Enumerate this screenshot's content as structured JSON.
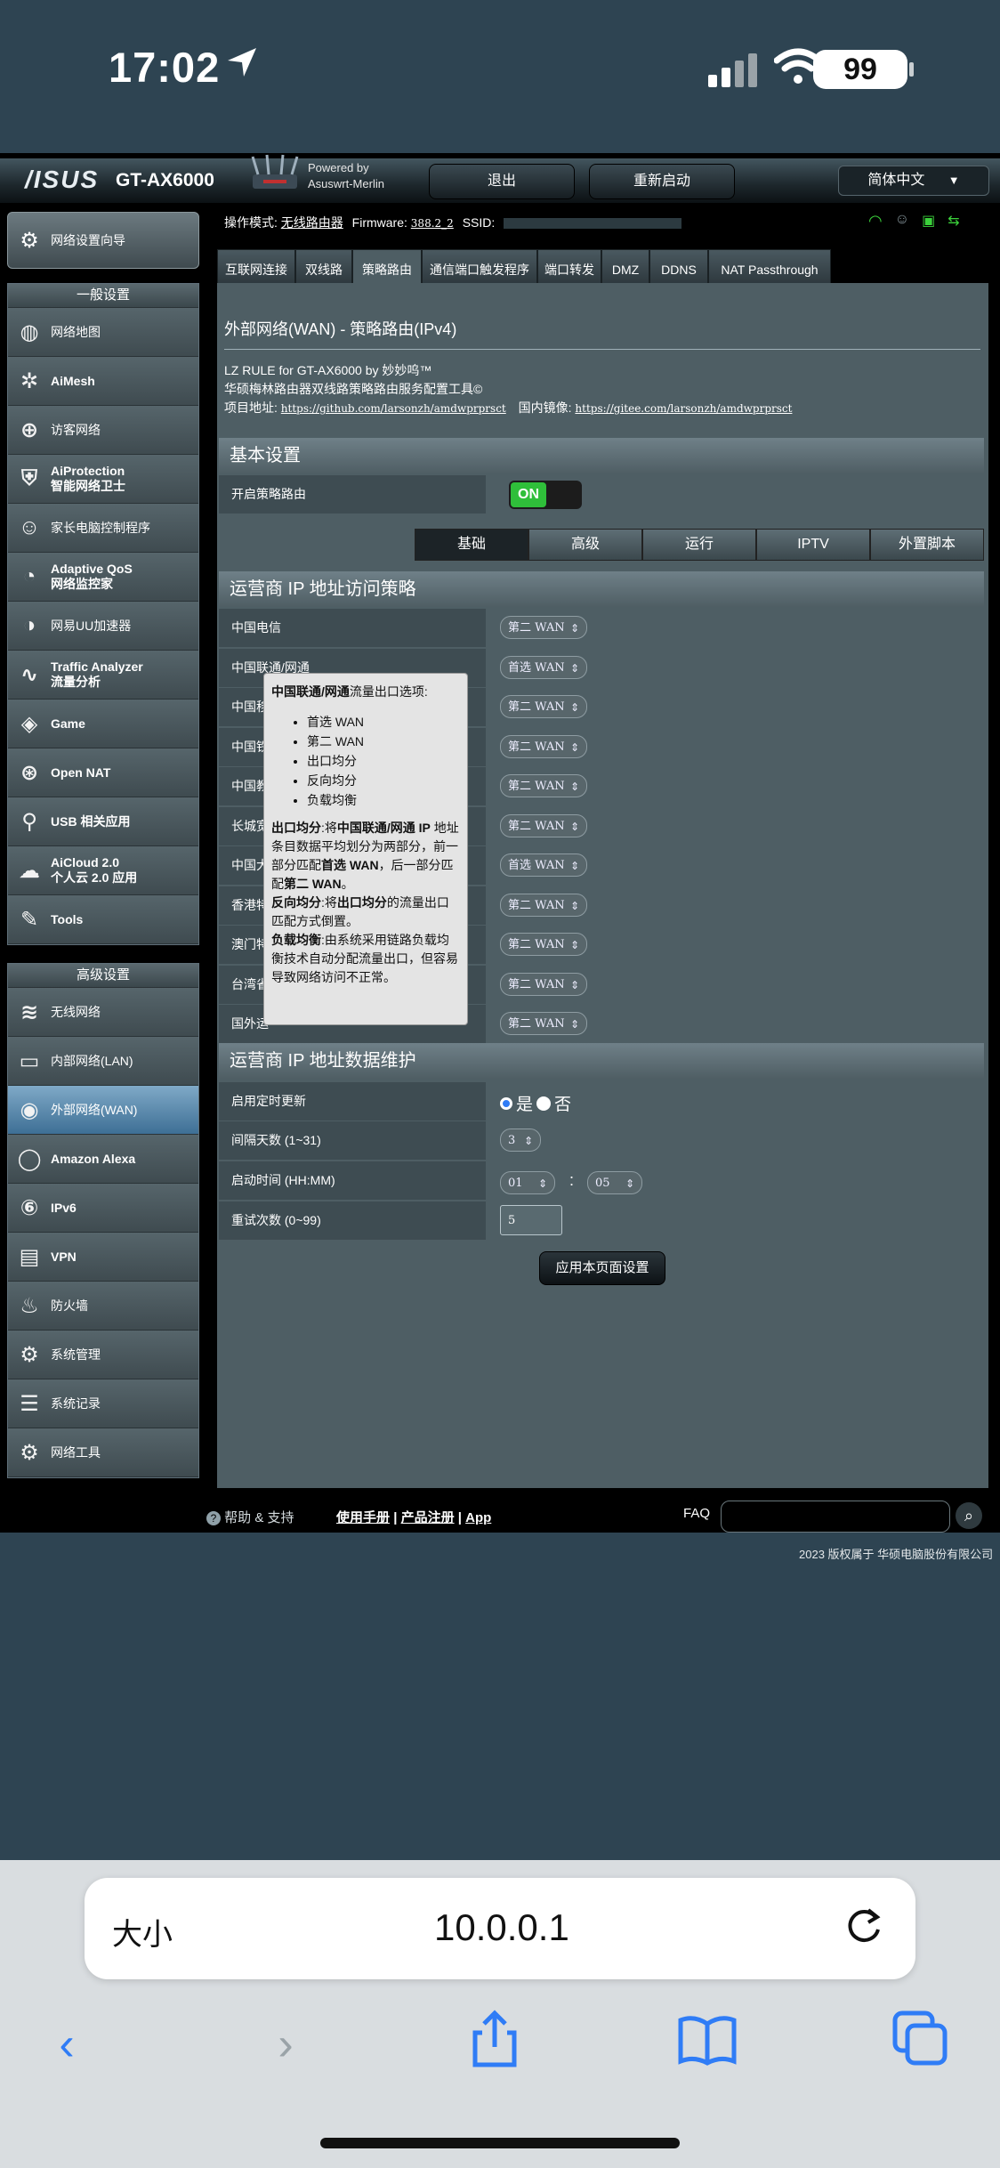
{
  "status_bar": {
    "time": "17:02",
    "battery": "99"
  },
  "header": {
    "logo": "/ISUS",
    "model": "GT-AX6000",
    "powered_by_line1": "Powered by",
    "powered_by_line2": "Asuswrt-Merlin",
    "logout_label": "退出",
    "reboot_label": "重新启动",
    "language": "简体中文"
  },
  "info_bar": {
    "op_mode_label": "操作模式:",
    "op_mode_value": "无线路由器",
    "firmware_label": "Firmware:",
    "firmware_value": "388.2_2",
    "ssid_label": "SSID:"
  },
  "sidebar": {
    "quick_setup": "网络设置向导",
    "general_header": "一般设置",
    "general_items": [
      {
        "icon": "network-map-icon",
        "label": "网络地图"
      },
      {
        "icon": "aimesh-icon",
        "label": "AiMesh"
      },
      {
        "icon": "guest-network-icon",
        "label": "访客网络"
      },
      {
        "icon": "aiprotection-icon",
        "label": "AiProtection",
        "label2": "智能网络卫士"
      },
      {
        "icon": "parental-control-icon",
        "label": "家长电脑控制程序"
      },
      {
        "icon": "qos-icon",
        "label": "Adaptive QoS",
        "label2": "网络监控家"
      },
      {
        "icon": "uu-accelerator-icon",
        "label": "网易UU加速器"
      },
      {
        "icon": "traffic-analyzer-icon",
        "label": "Traffic Analyzer",
        "label2": "流量分析"
      },
      {
        "icon": "game-icon",
        "label": "Game"
      },
      {
        "icon": "open-nat-icon",
        "label": "Open NAT"
      },
      {
        "icon": "usb-icon",
        "label": "USB 相关应用"
      },
      {
        "icon": "aicloud-icon",
        "label": "AiCloud 2.0",
        "label2": "个人云 2.0 应用"
      },
      {
        "icon": "tools-icon",
        "label": "Tools"
      }
    ],
    "advanced_header": "高级设置",
    "advanced_items": [
      {
        "icon": "wireless-icon",
        "label": "无线网络"
      },
      {
        "icon": "lan-icon",
        "label": "内部网络(LAN)"
      },
      {
        "icon": "wan-icon",
        "label": "外部网络(WAN)",
        "active": true
      },
      {
        "icon": "alexa-icon",
        "label": "Amazon Alexa"
      },
      {
        "icon": "ipv6-icon",
        "label": "IPv6"
      },
      {
        "icon": "vpn-icon",
        "label": "VPN"
      },
      {
        "icon": "firewall-icon",
        "label": "防火墙"
      },
      {
        "icon": "admin-icon",
        "label": "系统管理"
      },
      {
        "icon": "syslog-icon",
        "label": "系统记录"
      },
      {
        "icon": "network-tools-icon",
        "label": "网络工具"
      }
    ]
  },
  "tabs": [
    "互联网连接",
    "双线路",
    "策略路由",
    "通信端口触发程序",
    "端口转发",
    "DMZ",
    "DDNS",
    "NAT Passthrough"
  ],
  "page": {
    "title": "外部网络(WAN) - 策略路由(IPv4)",
    "desc1": "LZ RULE for GT-AX6000 by 妙妙呜™",
    "desc2": "华硕梅林路由器双线路策略路由服务配置工具©",
    "project_label": "项目地址:",
    "project_link": "https://github.com/larsonzh/amdwprprsct",
    "mirror_label": "国内镜像:",
    "mirror_link": "https://gitee.com/larsonzh/amdwprprsct"
  },
  "basic": {
    "header": "基本设置",
    "enable_label": "开启策略路由",
    "toggle": "ON"
  },
  "subtabs": [
    "基础",
    "高级",
    "运行",
    "IPTV",
    "外置脚本"
  ],
  "isp_section": {
    "header": "运营商 IP 地址访问策略",
    "rows": [
      {
        "label": "中国电信",
        "value": "第二 WAN"
      },
      {
        "label": "中国联通/网通",
        "value": "首选 WAN"
      },
      {
        "label": "中国移",
        "value": "第二 WAN"
      },
      {
        "label": "中国铁",
        "value": "第二 WAN"
      },
      {
        "label": "中国教",
        "value": "第二 WAN"
      },
      {
        "label": "长城宽",
        "value": "第二 WAN"
      },
      {
        "label": "中国大",
        "value": "首选 WAN"
      },
      {
        "label": "香港特",
        "value": "第二 WAN"
      },
      {
        "label": "澳门特",
        "value": "第二 WAN"
      },
      {
        "label": "台湾省",
        "value": "第二 WAN"
      },
      {
        "label": "国外运",
        "value": "第二 WAN"
      }
    ]
  },
  "tooltip": {
    "title_bold": "中国联通/网通",
    "title_rest": "流量出口选项:",
    "options": [
      "首选 WAN",
      "第二 WAN",
      "出口均分",
      "反向均分",
      "负载均衡"
    ],
    "p1_bold": "出口均分",
    "p1_a": ":将",
    "p1_b": "中国联通/网通 IP",
    "p1_c": " 地址条目数据平均划分为两部分，前一部分匹配",
    "p1_d": "首选 WAN",
    "p1_e": "，后一部分匹配",
    "p1_f": "第二 WAN",
    "p1_g": "。",
    "p2_bold": "反向均分",
    "p2_a": ":将",
    "p2_b": "出口均分",
    "p2_c": "的流量出口匹配方式倒置。",
    "p3_bold": "负载均衡",
    "p3_a": ":由系统采用链路负载均衡技术自动分配流量出口，但容易导致网络访问不正常。"
  },
  "maint_section": {
    "header": "运营商 IP 地址数据维护",
    "auto_update_label": "启用定时更新",
    "yes": "是",
    "no": "否",
    "interval_label": "间隔天数 (1~31)",
    "interval_value": "3",
    "time_label": "启动时间 (HH:MM)",
    "hour": "01",
    "colon": ":",
    "minute": "05",
    "retry_label": "重试次数 (0~99)",
    "retry_value": "5"
  },
  "apply_button": "应用本页面设置",
  "footer": {
    "help": "帮助 & 支持",
    "manual": "使用手册",
    "sep": "|",
    "register": "产品注册",
    "app": "App",
    "faq": "FAQ",
    "copyright": "2023 版权属于 华硕电脑股份有限公司"
  },
  "safari": {
    "text_size": "大小",
    "url": "10.0.0.1"
  }
}
